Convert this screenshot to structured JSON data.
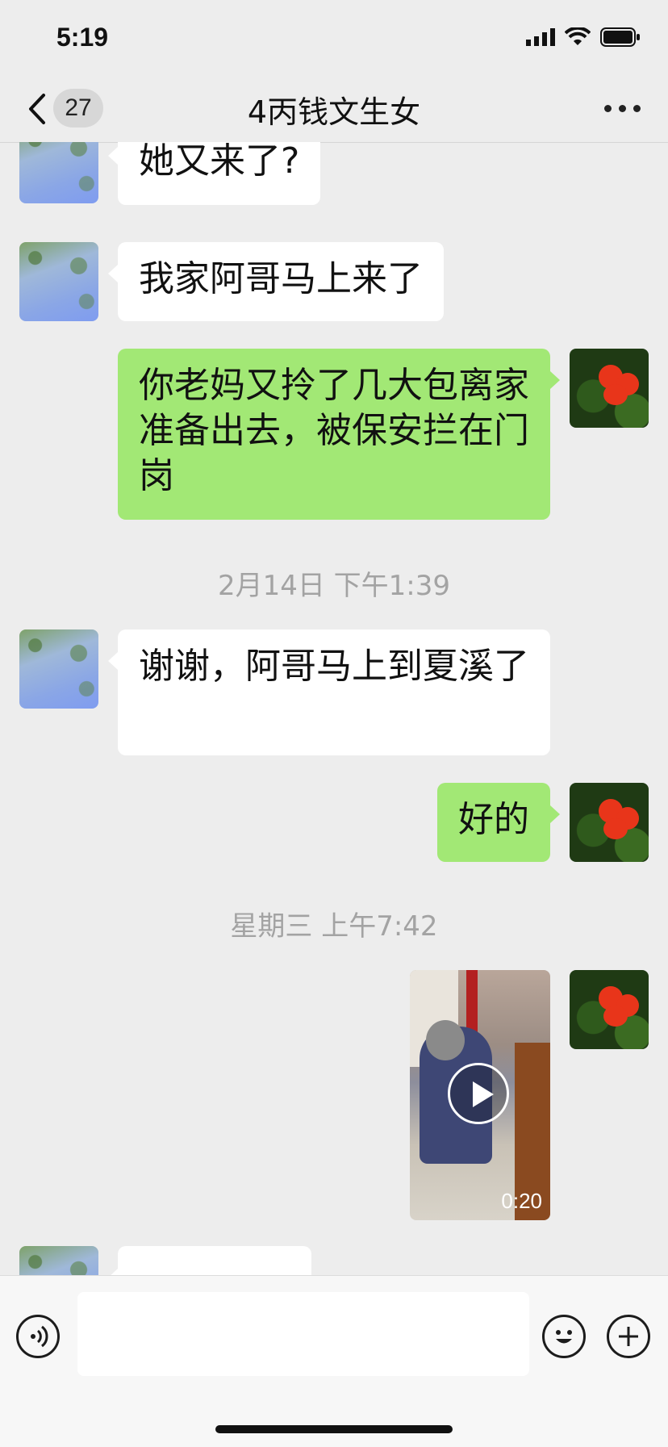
{
  "status_bar": {
    "time": "5:19"
  },
  "nav": {
    "back_badge": "27",
    "title": "4丙钱文生女"
  },
  "messages": [
    {
      "text": "她又来了?"
    },
    {
      "text": "我家阿哥马上来了"
    },
    {
      "text": "你老妈又拎了几大包离家准备出去，被保安拦在门岗"
    },
    {
      "text": "谢谢，阿哥马上到夏溪了"
    },
    {
      "text": "好的"
    }
  ],
  "timestamps": [
    "2月14日 下午1:39",
    "星期三 上午7:42"
  ],
  "video": {
    "duration": "0:20"
  },
  "input_bar": {
    "placeholder": ""
  },
  "icons": {
    "back": "chevron-left-icon",
    "more": "more-dots-icon",
    "voice": "voice-icon",
    "emoji": "emoji-icon",
    "plus": "plus-icon",
    "play": "play-icon"
  },
  "colors": {
    "outgoing_bubble": "#a2e875",
    "incoming_bubble": "#ffffff",
    "background": "#ededed"
  }
}
